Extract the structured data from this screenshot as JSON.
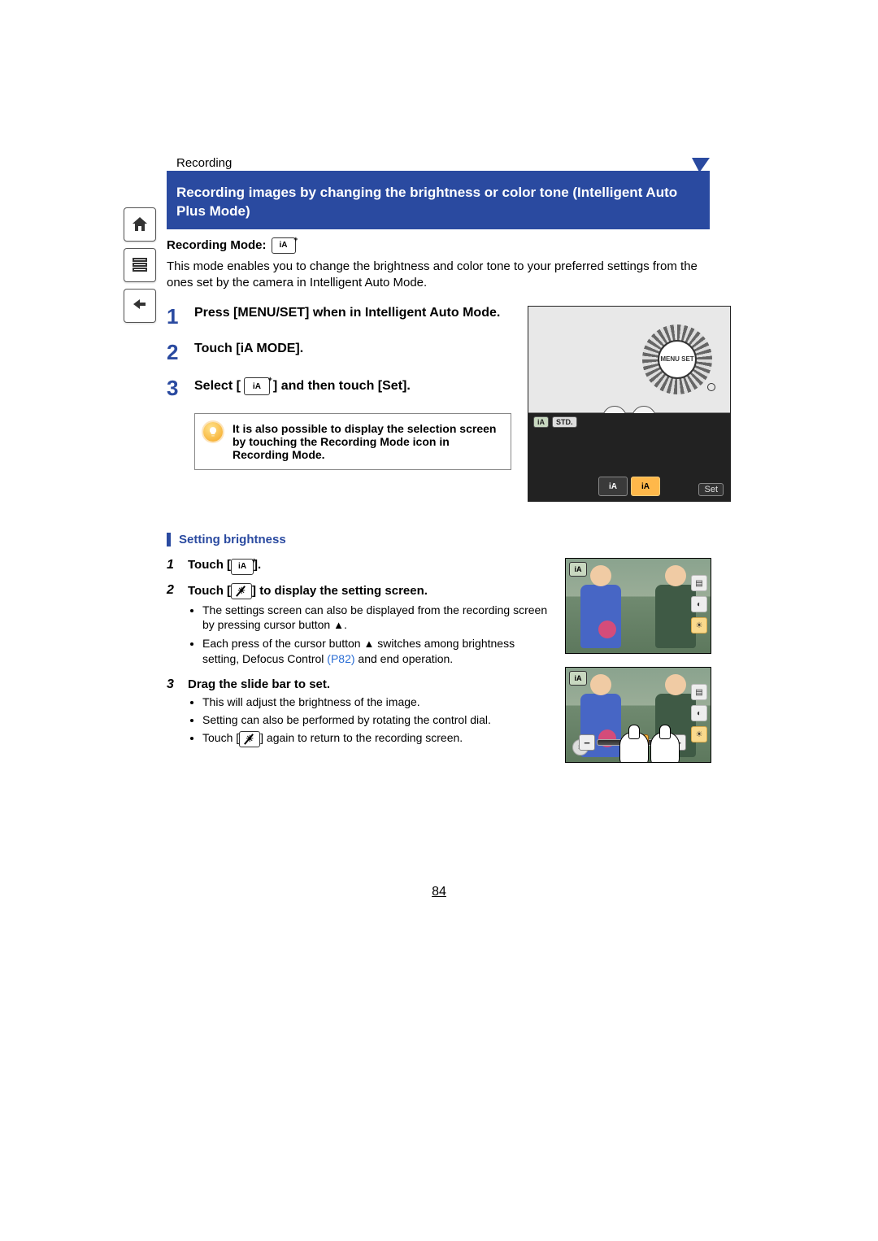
{
  "section": "Recording",
  "title": "Recording images by changing the brightness or color tone (Intelligent Auto Plus Mode)",
  "recording_mode_label": "Recording Mode:",
  "intro": "This mode enables you to change the brightness and color tone to your preferred settings from the ones set by the camera in Intelligent Auto Mode.",
  "steps": [
    {
      "num": "1",
      "text": "Press [MENU/SET] when in Intelligent Auto Mode."
    },
    {
      "num": "2",
      "text": "Touch [iA MODE]."
    },
    {
      "num": "3",
      "pre": "Select [",
      "post": "] and then touch [Set]."
    }
  ],
  "tip": "It is also possible to display the selection screen by touching the Recording Mode icon in Recording Mode.",
  "camera": {
    "dial_center": "MENU SET",
    "screen_tags": [
      "iA",
      "STD."
    ],
    "mode_buttons": [
      "iA",
      "iA"
    ],
    "set_label": "Set"
  },
  "subsection_title": "Setting brightness",
  "substeps": [
    {
      "num": "1",
      "title_pre": "Touch [",
      "title_post": "]."
    },
    {
      "num": "2",
      "title_pre": "Touch [",
      "title_post": "] to display the setting screen.",
      "bullets": [
        {
          "text_a": "The settings screen can also be displayed from the recording screen by pressing cursor button ",
          "arrow": "▲",
          "text_b": "."
        },
        {
          "text_a": "Each press of the cursor button ",
          "arrow": "▲",
          "text_b": " switches among brightness setting, Defocus Control ",
          "link": "(P82)",
          "text_c": " and end operation."
        }
      ]
    },
    {
      "num": "3",
      "title": "Drag the slide bar to set.",
      "bullets_plain": [
        "This will adjust the brightness of the image.",
        "Setting can also be performed by rotating the control dial."
      ],
      "bullet_icon_pre": "Touch [",
      "bullet_icon_post": "] again to return to the recording screen."
    }
  ],
  "thumb_badge": "iA",
  "page_number": "84"
}
